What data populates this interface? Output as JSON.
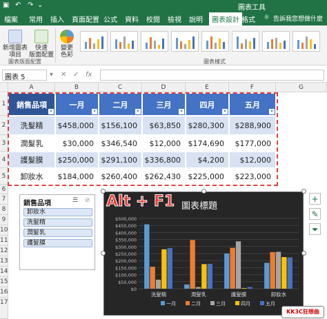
{
  "titlebar": {
    "tool_title": "圖表工具"
  },
  "tabs": [
    {
      "label": "檔案"
    },
    {
      "label": "常用"
    },
    {
      "label": "插入"
    },
    {
      "label": "頁面配置"
    },
    {
      "label": "公式"
    },
    {
      "label": "資料"
    },
    {
      "label": "校閱"
    },
    {
      "label": "檢視"
    },
    {
      "label": "說明"
    },
    {
      "label": "圖表設計"
    },
    {
      "label": "格式"
    }
  ],
  "tell_me": "告訴我您想做什麼",
  "ribbon": {
    "add_element_l1": "新增圖表",
    "add_element_l2": "項目",
    "quick_layout_l1": "快速",
    "quick_layout_l2": "版面配置",
    "change_colors_l1": "變更",
    "change_colors_l2": "色彩",
    "group_layout": "圖表版面配置",
    "group_styles": "圖表樣式"
  },
  "formula": {
    "name_box": "圖表 5",
    "cancel": "✕",
    "enter": "✓",
    "fx": "fx"
  },
  "columns": [
    "A",
    "B",
    "C",
    "D",
    "E",
    "F",
    "G"
  ],
  "rows": [
    "1",
    "2",
    "3",
    "4",
    "5",
    "6",
    "7",
    "8",
    "9",
    "10",
    "11",
    "12",
    "13",
    "14",
    "15",
    "16",
    "17"
  ],
  "table": {
    "header": [
      "銷售品項",
      "一月",
      "二月",
      "三月",
      "四月",
      "五月"
    ],
    "rows": [
      [
        "洗髮精",
        "$458,000",
        "$156,100",
        "$63,850",
        "$280,300",
        "$288,900"
      ],
      [
        "潤髮乳",
        "$30,000",
        "$346,540",
        "$12,000",
        "$174,690",
        "$177,000"
      ],
      [
        "護髮膜",
        "$250,000",
        "$291,100",
        "$336,800",
        "$4,200",
        "$12,000"
      ],
      [
        "卸妝水",
        "$184,000",
        "$260,400",
        "$262,430",
        "$225,000",
        "$223,000"
      ]
    ]
  },
  "slicer": {
    "title": "銷售品項",
    "items": [
      "卸妝水",
      "洗髮精",
      "潤髮乳",
      "護髮膜"
    ]
  },
  "overlay_text": "Alt + F1",
  "logo_text": "KK3C狂想曲",
  "chart_data": {
    "type": "bar",
    "title": "圖表標題",
    "categories": [
      "洗髮精",
      "潤髮乳",
      "護髮膜",
      "卸妝水"
    ],
    "series": [
      {
        "name": "一月",
        "values": [
          458000,
          30000,
          250000,
          184000
        ],
        "color": "#5b9bd5"
      },
      {
        "name": "二月",
        "values": [
          156100,
          346540,
          291100,
          260400
        ],
        "color": "#ed7d31"
      },
      {
        "name": "三月",
        "values": [
          63850,
          12000,
          336800,
          262430
        ],
        "color": "#a5a5a5"
      },
      {
        "name": "四月",
        "values": [
          280300,
          174690,
          4200,
          225000
        ],
        "color": "#ffc000"
      },
      {
        "name": "五月",
        "values": [
          288900,
          177000,
          12000,
          223000
        ],
        "color": "#4472c4"
      }
    ],
    "yticks": [
      "$0",
      "$50,000",
      "$100,000",
      "$150,000",
      "$200,000",
      "$250,000",
      "$300,000",
      "$350,000",
      "$400,000",
      "$450,000",
      "$500,000"
    ],
    "ylim": [
      0,
      500000
    ],
    "legend_position": "bottom",
    "grid": true,
    "background": "#262626"
  }
}
